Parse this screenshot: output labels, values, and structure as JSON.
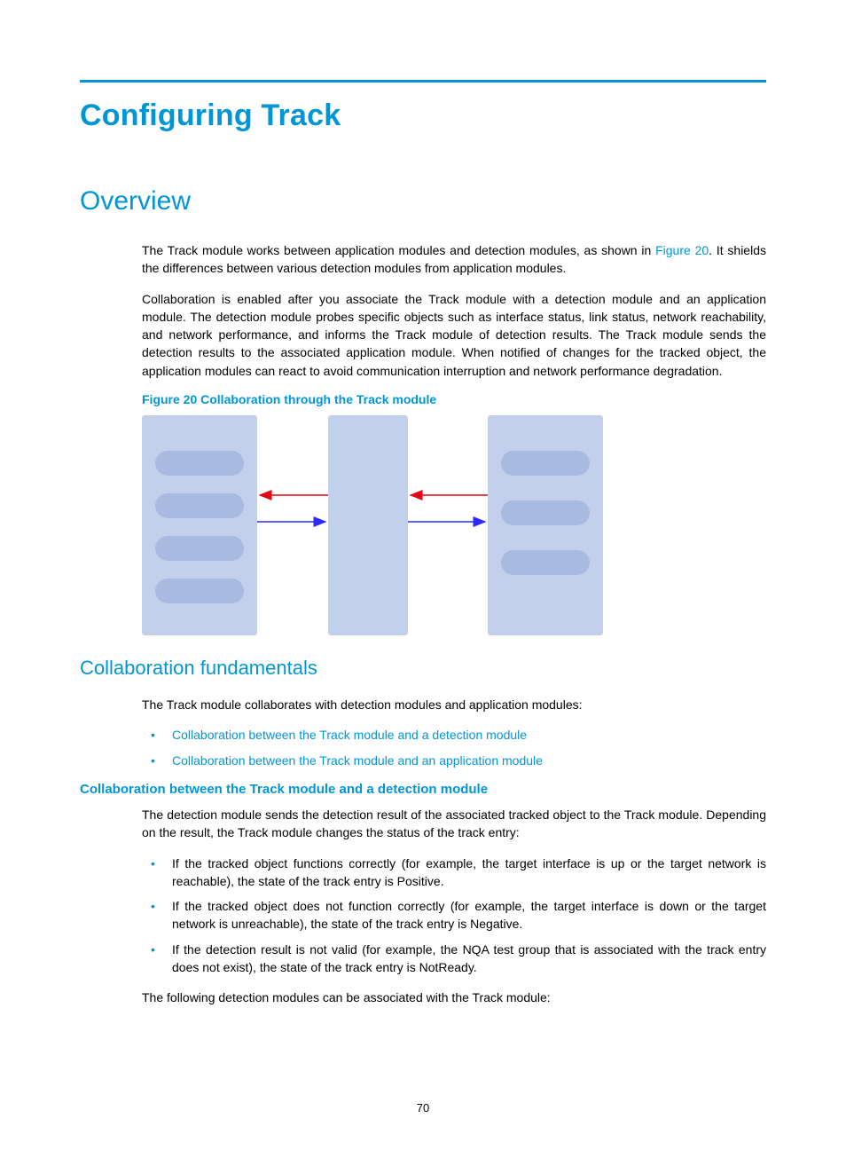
{
  "page": {
    "number": "70"
  },
  "title": "Configuring Track",
  "sections": {
    "overview": {
      "heading": "Overview",
      "p1_a": "The Track module works between application modules and detection modules, as shown in ",
      "p1_link": "Figure 20",
      "p1_b": ". It shields the differences between various detection modules from application modules.",
      "p2": "Collaboration is enabled after you associate the Track module with a detection module and an application module. The detection module probes specific objects such as interface status, link status, network reachability, and network performance, and informs the Track module of detection results. The Track module sends the detection results to the associated application module. When notified of changes for the tracked object, the application modules can react to avoid communication interruption and network performance degradation.",
      "figure_caption": "Figure 20 Collaboration through the Track module"
    },
    "collab": {
      "heading": "Collaboration fundamentals",
      "intro": "The Track module collaborates with detection modules and application modules:",
      "links": [
        "Collaboration between the Track module and a detection module",
        "Collaboration between the Track module and an application module"
      ],
      "sub1": {
        "heading": "Collaboration between the Track module and a detection module",
        "p1": "The detection module sends the detection result of the associated tracked object to the Track module. Depending on the result, the Track module changes the status of the track entry:",
        "bullets": [
          "If the tracked object functions correctly (for example, the target interface is up or the target network is reachable), the state of the track entry is Positive.",
          "If the tracked object does not function correctly (for example, the target interface is down or the target network is unreachable), the state of the track entry is Negative.",
          "If the detection result is not valid (for example, the NQA test group that is associated with the track entry does not exist), the state of the track entry is NotReady."
        ],
        "p2": "The following detection modules can be associated with the Track module:"
      }
    }
  }
}
